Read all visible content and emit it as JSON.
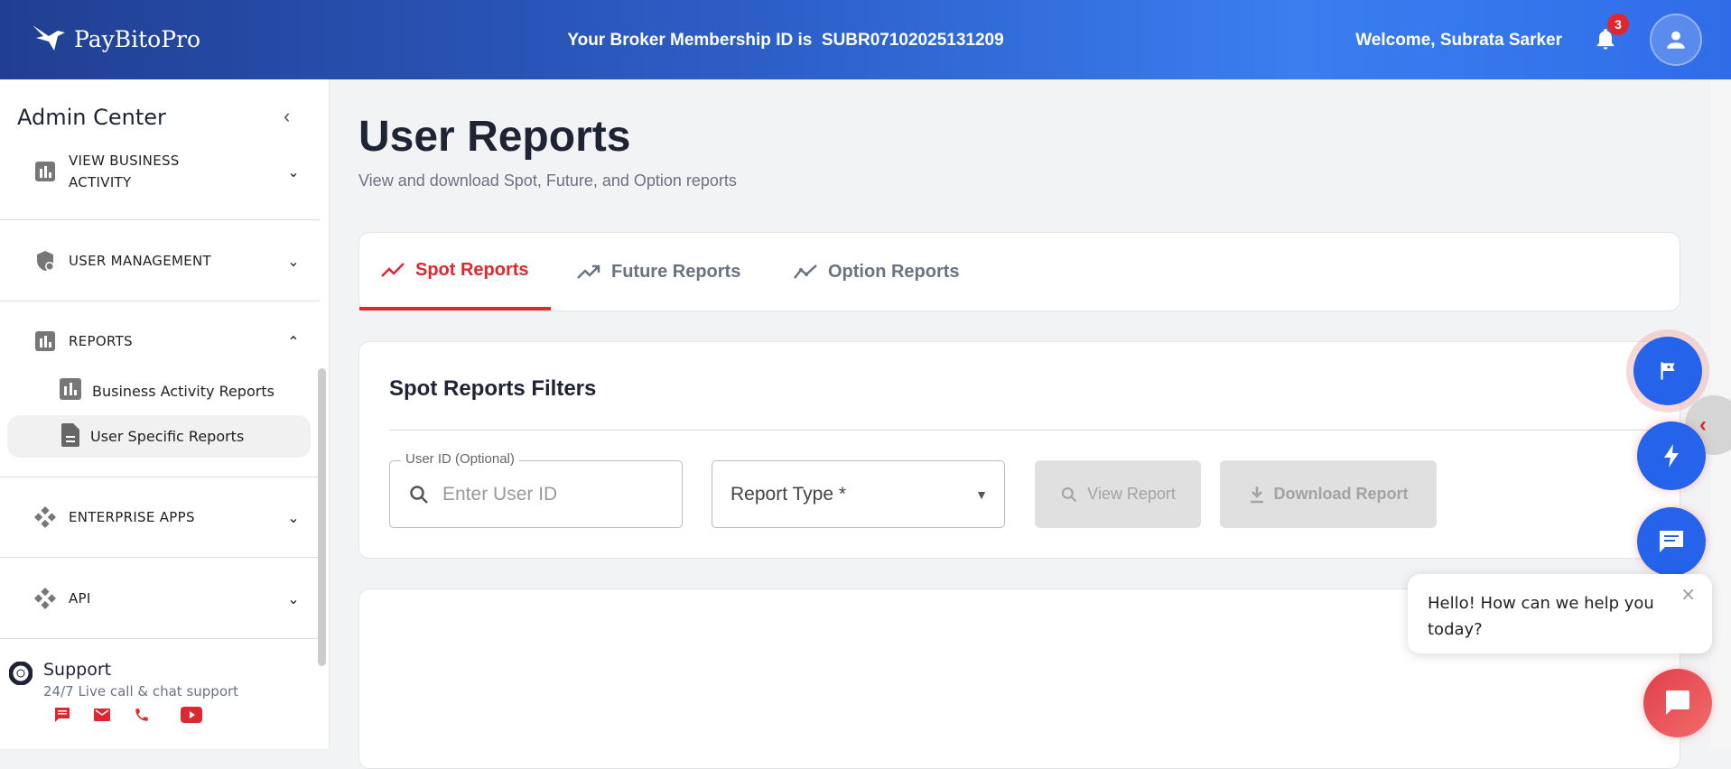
{
  "header": {
    "brand": "PayBitoPro",
    "membership_label": "Your Broker Membership ID is",
    "membership_id": "SUBR07102025131209",
    "welcome": "Welcome, Subrata Sarker",
    "notification_count": "3"
  },
  "sidebar": {
    "title": "Admin Center",
    "items": [
      {
        "label": "VIEW BUSINESS ACTIVITY"
      },
      {
        "label": "USER MANAGEMENT"
      },
      {
        "label": "REPORTS"
      },
      {
        "label": "ENTERPRISE APPS"
      },
      {
        "label": "API"
      }
    ],
    "reports_sub": [
      {
        "label": "Business Activity Reports"
      },
      {
        "label": "User Specific Reports"
      }
    ],
    "support": {
      "title": "Support",
      "subtitle": "24/7 Live call & chat support"
    }
  },
  "main": {
    "title": "User Reports",
    "subtitle": "View and download Spot, Future, and Option reports",
    "tabs": [
      {
        "label": "Spot Reports"
      },
      {
        "label": "Future Reports"
      },
      {
        "label": "Option Reports"
      }
    ],
    "filters": {
      "heading": "Spot Reports Filters",
      "user_id_label": "User ID (Optional)",
      "user_id_placeholder": "Enter User ID",
      "report_type": "Report Type *",
      "view_button": "View Report",
      "download_button": "Download Report"
    }
  },
  "chat": {
    "message": "Hello! How can we help you today?",
    "close": "×"
  },
  "colors": {
    "accent": "#e0262e",
    "primary": "#2563eb"
  }
}
